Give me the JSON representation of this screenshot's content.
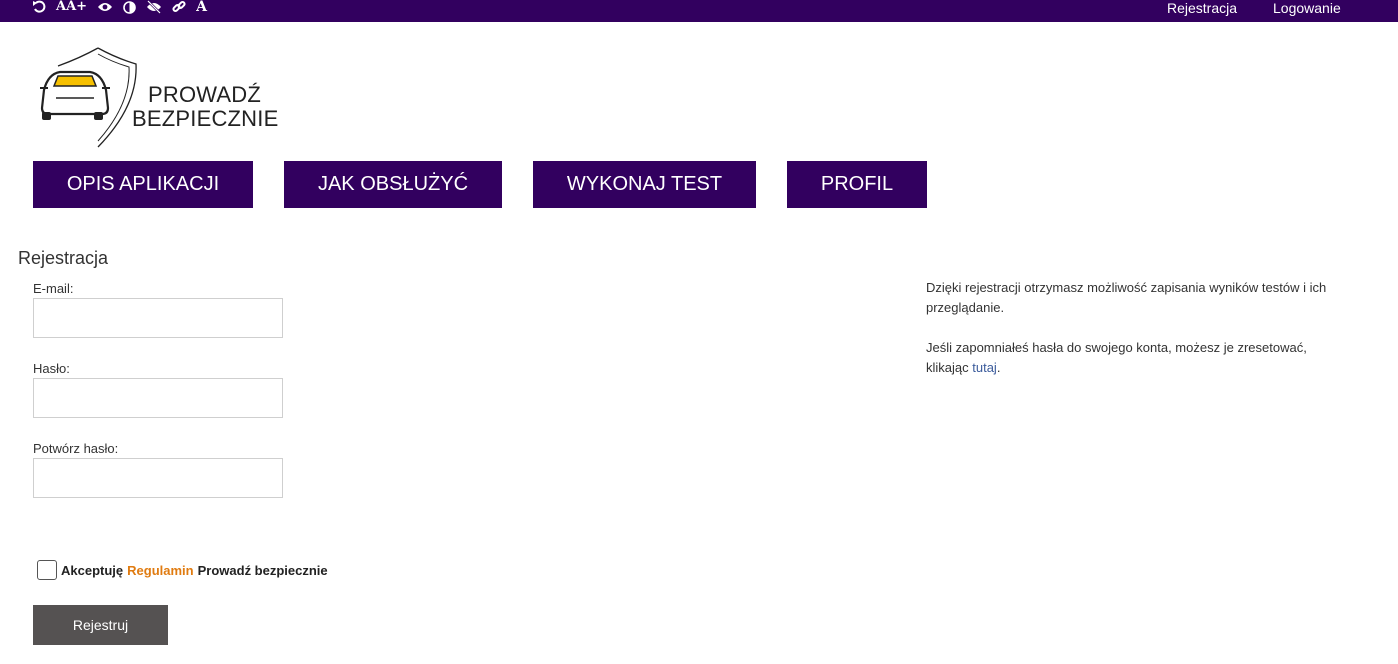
{
  "topbar": {
    "accessibility_icons": [
      "reset-icon",
      "font-size-increase-icon",
      "eye-icon",
      "contrast-icon",
      "hide-icon",
      "link-icon",
      "font-icon"
    ],
    "font_icon_text": "A",
    "font_size_icon_text": "AA+",
    "links": {
      "register": "Rejestracja",
      "login": "Logowanie"
    }
  },
  "logo": {
    "line1": "PROWADŹ",
    "line2": "BEZPIECZNIE"
  },
  "nav": {
    "items": [
      {
        "label": "OPIS APLIKACJI"
      },
      {
        "label": "JAK OBSŁUŻYĆ"
      },
      {
        "label": "WYKONAJ TEST"
      },
      {
        "label": "PROFIL"
      }
    ]
  },
  "form": {
    "title": "Rejestracja",
    "email_label": "E-mail:",
    "email_value": "",
    "password_label": "Hasło:",
    "password_value": "",
    "confirm_label": "Potwórz hasło:",
    "confirm_value": "",
    "terms_prefix": "Akceptuję",
    "terms_link": "Regulamin",
    "terms_suffix": "Prowadź bezpiecznie",
    "submit_label": "Rejestruj"
  },
  "info": {
    "paragraph1": "Dzięki rejestracji otrzymasz możliwość zapisania wyników testów i ich przeglądanie.",
    "paragraph2_text": "Jeśli zapomniałeś hasła do swojego konta, możesz je zresetować, klikając",
    "paragraph2_link": "tutaj",
    "paragraph2_end": "."
  },
  "colors": {
    "brand": "#32005f",
    "accent": "#e07b10",
    "button": "#555252",
    "link": "#3b5b9b",
    "car_window": "#f6c000"
  }
}
